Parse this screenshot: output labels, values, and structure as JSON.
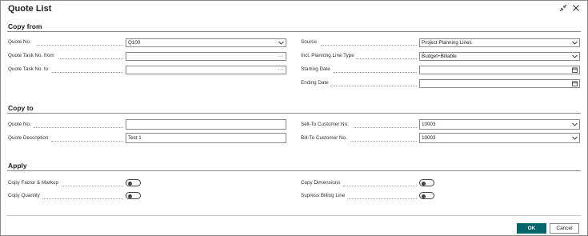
{
  "dialog": {
    "title": "Quote List"
  },
  "copy_from": {
    "title": "Copy from",
    "quote_no": {
      "label": "Quote No.",
      "value": "Q100"
    },
    "quote_task_from": {
      "label": "Quote Task No. from",
      "value": ""
    },
    "quote_task_to": {
      "label": "Quote Task No. to",
      "value": ""
    },
    "source": {
      "label": "Source",
      "value": "Project Planning Lines"
    },
    "incl_planning_line_type": {
      "label": "Incl. Planning Line Type",
      "value": "Budget+Billable"
    },
    "starting_date": {
      "label": "Starting Date",
      "value": ""
    },
    "ending_date": {
      "label": "Ending Date",
      "value": ""
    }
  },
  "copy_to": {
    "title": "Copy to",
    "quote_no": {
      "label": "Quote No.",
      "value": ""
    },
    "quote_description": {
      "label": "Quote Description",
      "value": "Test 1"
    },
    "sell_to_customer_no": {
      "label": "Sell-To Customer No.",
      "value": "10003"
    },
    "bill_to_customer_no": {
      "label": "Bill-To Customer No.",
      "value": "10003"
    }
  },
  "apply": {
    "title": "Apply",
    "copy_factor_markup": {
      "label": "Copy Factor & Markup",
      "on": false
    },
    "copy_quantity": {
      "label": "Copy Quantity",
      "on": false
    },
    "copy_dimensions": {
      "label": "Copy Dimensions",
      "on": false
    },
    "supress_billing_line": {
      "label": "Supress Billing Line",
      "on": false
    }
  },
  "footer": {
    "ok_label": "OK",
    "cancel_label": "Cancel"
  },
  "colors": {
    "primary": "#00666b",
    "border": "#8a8a8a"
  },
  "icons": {
    "collapse": "collapse-icon",
    "close": "close-icon",
    "dropdown": "chevron-down-icon",
    "lookup": "ellipsis-icon",
    "calendar": "calendar-icon"
  }
}
